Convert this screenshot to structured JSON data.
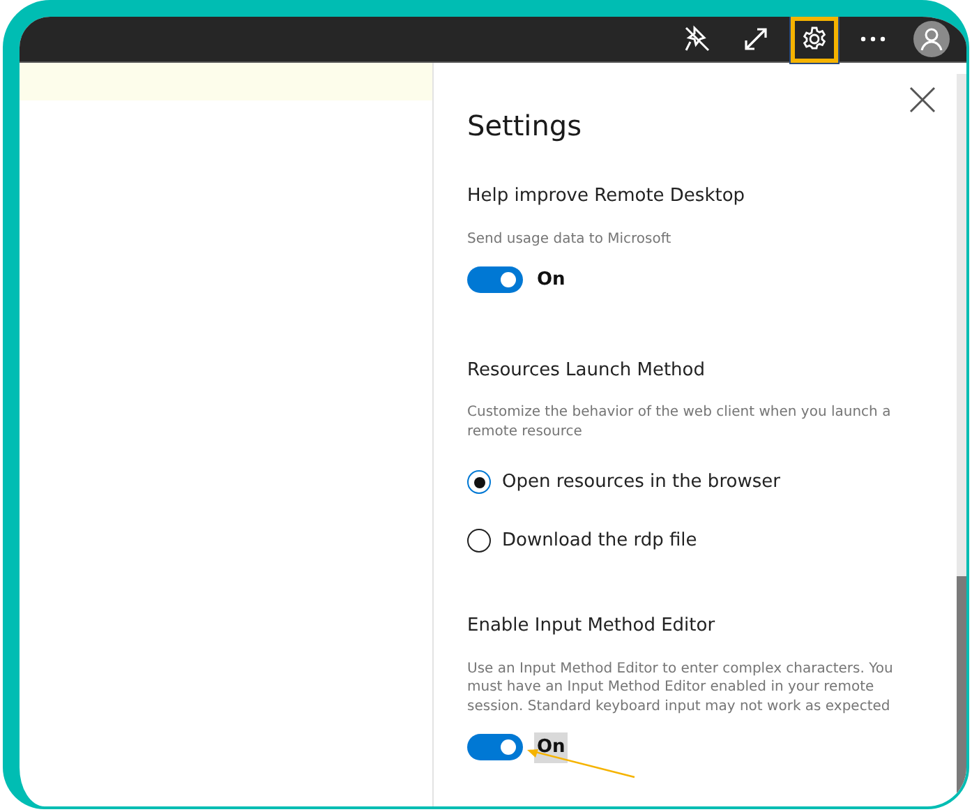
{
  "toolbar": {
    "buttons": [
      {
        "kind": "pin",
        "selected": false
      },
      {
        "kind": "expand",
        "selected": false
      },
      {
        "kind": "settings",
        "selected": true
      },
      {
        "kind": "more",
        "selected": false
      },
      {
        "kind": "avatar",
        "selected": false
      }
    ]
  },
  "settings": {
    "title": "Settings",
    "sections": [
      {
        "kind": "toggle",
        "heading": "Help improve Remote Desktop",
        "description": "Send usage data to Microsoft",
        "on": true,
        "state_label": "On",
        "highlighted": false
      },
      {
        "kind": "radio",
        "heading": "Resources Launch Method",
        "description": "Customize the behavior of the web client when you launch a remote resource",
        "options": [
          {
            "label": "Open resources in the browser",
            "selected": true
          },
          {
            "label": "Download the rdp file",
            "selected": false
          }
        ]
      },
      {
        "kind": "toggle",
        "heading": "Enable Input Method Editor",
        "description": "Use an Input Method Editor to enter complex characters. You must have an Input Method Editor enabled in your remote session. Standard keyboard input may not work as expected",
        "on": true,
        "state_label": "On",
        "highlighted": true,
        "pointer": true
      }
    ]
  }
}
